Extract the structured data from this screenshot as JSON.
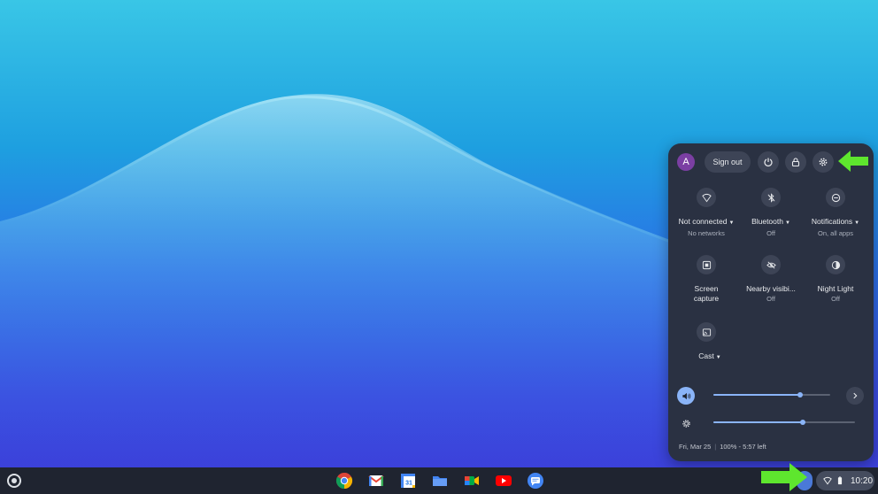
{
  "quick_settings": {
    "avatar_letter": "A",
    "sign_out_label": "Sign out",
    "buttons": [
      "power-icon",
      "lock-icon",
      "gear-icon"
    ],
    "tiles": [
      {
        "label": "Not connected",
        "sub": "No networks",
        "icon": "wifi-icon",
        "dropdown": true
      },
      {
        "label": "Bluetooth",
        "sub": "Off",
        "icon": "bluetooth-icon",
        "dropdown": true
      },
      {
        "label": "Notifications",
        "sub": "On, all apps",
        "icon": "do-not-disturb-icon",
        "dropdown": true
      },
      {
        "label": "Screen",
        "label2": "capture",
        "icon": "screen-capture-icon"
      },
      {
        "label": "Nearby visibi...",
        "sub": "Off",
        "icon": "nearby-visibility-icon"
      },
      {
        "label": "Night Light",
        "sub": "Off",
        "icon": "night-light-icon"
      },
      {
        "label": "Cast",
        "icon": "cast-icon",
        "dropdown": true
      }
    ],
    "volume_level": 0.74,
    "brightness_level": 0.63,
    "date": "Fri, Mar 25",
    "battery": "100% - 5:57 left",
    "accent_color": "#8ab4f8"
  },
  "shelf": {
    "apps": [
      "chrome-icon",
      "gmail-icon",
      "calendar-icon",
      "files-icon",
      "meet-icon",
      "youtube-icon",
      "messages-icon"
    ],
    "calendar_day": "31",
    "time": "10:20"
  },
  "annotations": {
    "arrow_color": "#5ee62e"
  }
}
